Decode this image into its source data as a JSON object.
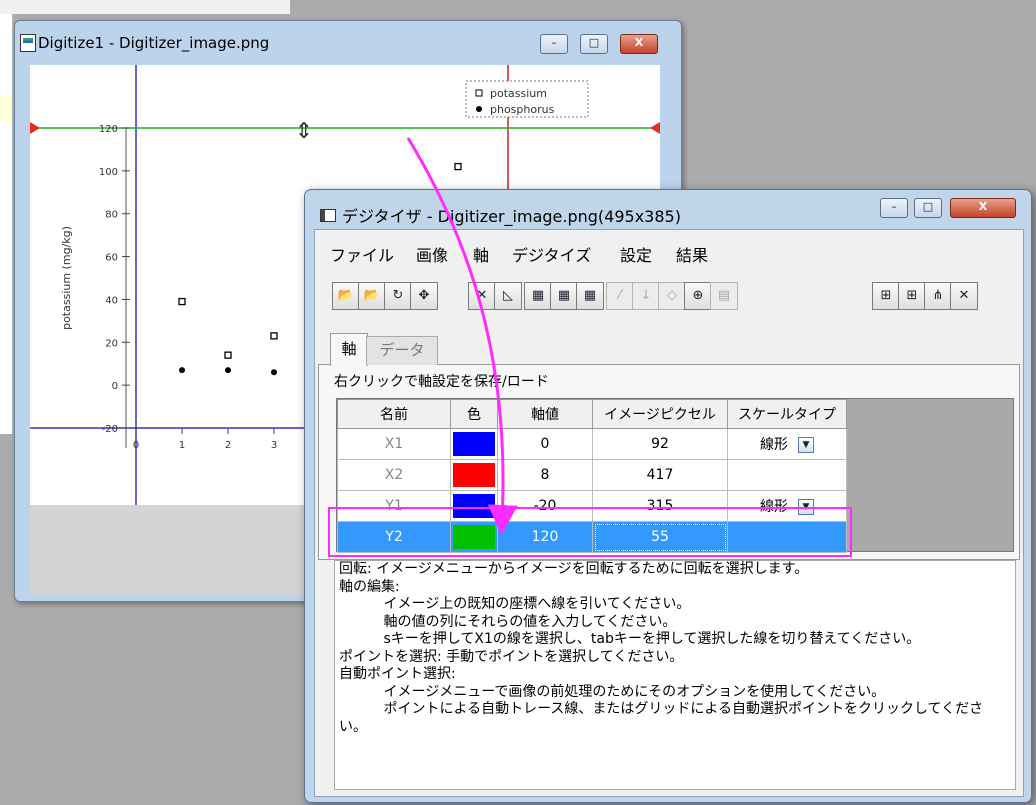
{
  "digitize_window": {
    "title": "Digitize1 - Digitizer_image.png",
    "minimize": "–",
    "maximize": "□",
    "close": "X"
  },
  "chart_data": {
    "type": "scatter",
    "ylabel": "potassium (mg/kg)",
    "x_ticks": [
      "0",
      "1",
      "2",
      "3"
    ],
    "y_ticks": [
      "120",
      "100",
      "80",
      "60",
      "40",
      "20",
      "0",
      "-20"
    ],
    "ylim": [
      -20,
      120
    ],
    "xlim": [
      0,
      8
    ],
    "legend_position": "top-right",
    "series": [
      {
        "name": "potassium",
        "marker": "open-square",
        "x": [
          1,
          2,
          3,
          7
        ],
        "y": [
          39,
          14,
          23,
          102
        ]
      },
      {
        "name": "phosphorus",
        "marker": "filled-circle",
        "x": [
          1,
          2,
          3
        ],
        "y": [
          7,
          7,
          6
        ]
      }
    ]
  },
  "dialog": {
    "title": "デジタイザ - Digitizer_image.png(495x385)",
    "menu": [
      "ファイル",
      "画像",
      "軸",
      "デジタイズ",
      "設定",
      "結果"
    ],
    "tabs": [
      "軸",
      "データ"
    ],
    "hint": "右クリックで軸設定を保存/ロード",
    "table": {
      "headers": [
        "名前",
        "色",
        "軸値",
        "イメージピクセル",
        "スケールタイプ"
      ],
      "rows": [
        {
          "name": "X1",
          "color": "#0000ff",
          "value": "0",
          "pixel": "92",
          "scale": "線形"
        },
        {
          "name": "X2",
          "color": "#ff0000",
          "value": "8",
          "pixel": "417",
          "scale": ""
        },
        {
          "name": "Y1",
          "color": "#0000ff",
          "value": "-20",
          "pixel": "315",
          "scale": "線形"
        },
        {
          "name": "Y2",
          "color": "#00c000",
          "value": "120",
          "pixel": "55",
          "scale": ""
        }
      ]
    },
    "info_lines": [
      "回転: イメージメニューからイメージを回転するために回転を選択します。",
      "軸の編集:",
      "          イメージ上の既知の座標へ線を引いてください。",
      "          軸の値の列にそれらの値を入力してください。",
      "          sキーを押してX1の線を選択し、tabキーを押して選択した線を切り替えてください。",
      "ポイントを選択: 手動でポイントを選択してください。",
      "自動ポイント選択:",
      "          イメージメニューで画像の前処理のためにそのオプションを使用してください。",
      "          ポイントによる自動トレース線、またはグリッドによる自動選択ポイントをクリックしてくださ",
      "い。"
    ]
  },
  "colors": {
    "selection": "#3399ff",
    "highlight": "#ff2bff",
    "axis_line": "#3030c8",
    "pick_line": "#20b020"
  }
}
